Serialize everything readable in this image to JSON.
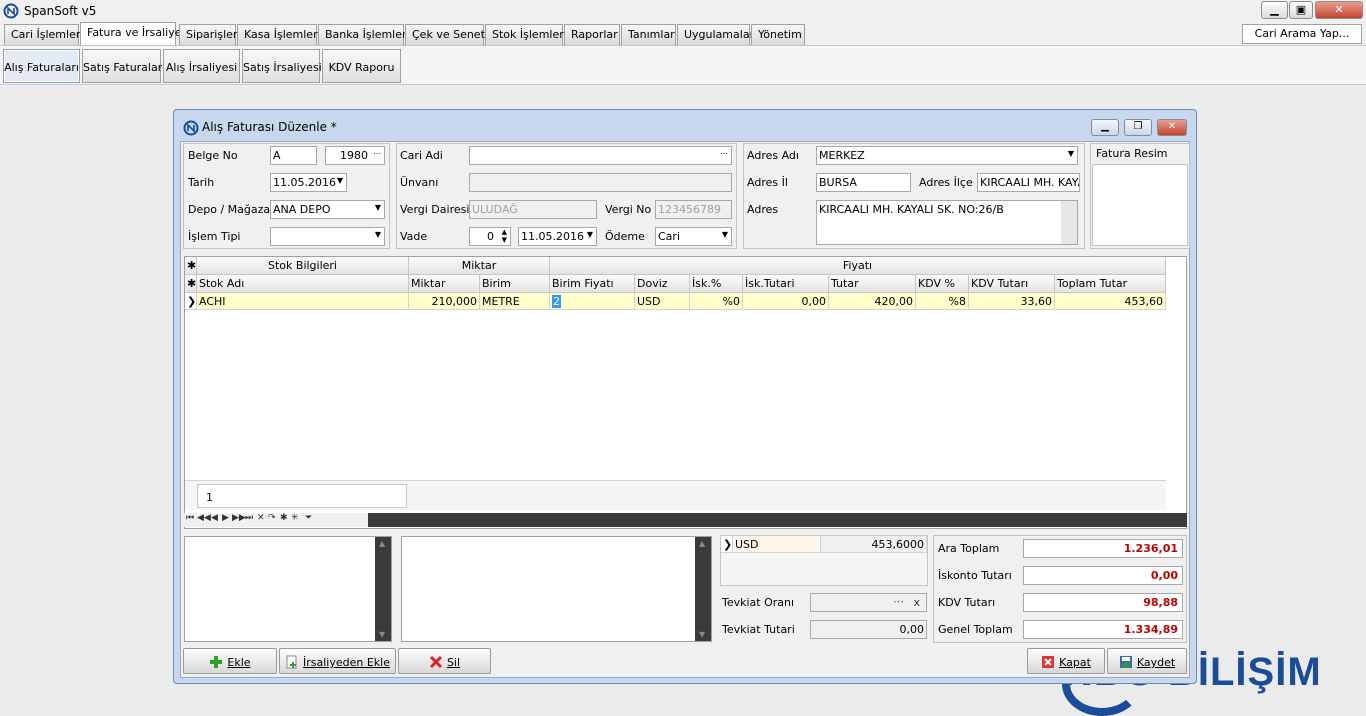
{
  "app": {
    "title": "SpanSoft v5"
  },
  "menu": {
    "tabs": [
      "Cari İşlemleri",
      "Fatura ve İrsaliye",
      "Siparişler",
      "Kasa İşlemleri",
      "Banka İşlemleri",
      "Çek ve Senet",
      "Stok İşlemleri",
      "Raporlar",
      "Tanımlar",
      "Uygulamalar",
      "Yönetim"
    ],
    "active": "Fatura ve İrsaliye",
    "search_label": "Cari Arama Yap..."
  },
  "submenu": {
    "tabs": [
      "Alış Faturaları",
      "Satış Faturaları",
      "Alış İrsaliyesi",
      "Satış İrsaliyesi",
      "KDV Raporu"
    ],
    "active": "Alış Faturaları"
  },
  "dialog": {
    "title": "Alış Faturası Düzenle *",
    "header": {
      "belge_no_label": "Belge No",
      "belge_seri": "A",
      "belge_no": "1980",
      "tarih_label": "Tarih",
      "tarih": "11.05.2016",
      "depo_label": "Depo / Mağaza",
      "depo": "ANA DEPO",
      "islem_tipi_label": "İşlem Tipi",
      "islem_tipi": "",
      "cari_adi_label": "Cari Adi",
      "cari_adi": "",
      "unvan_label": "Ünvanı",
      "unvan": "",
      "vergi_dairesi_label": "Vergi Dairesi",
      "vergi_dairesi": "ULUDAĞ",
      "vergi_no_label": "Vergi No",
      "vergi_no": "123456789",
      "vade_label": "Vade",
      "vade": "0",
      "vade_tarih": "11.05.2016",
      "odeme_label": "Ödeme",
      "odeme": "Cari",
      "adres_adi_label": "Adres Adı",
      "adres_adi": "MERKEZ",
      "adres_il_label": "Adres İl",
      "adres_il": "BURSA",
      "adres_ilce_label": "Adres İlçe",
      "adres_ilce": "KIRCAALI MH. KAYALI",
      "adres_label": "Adres",
      "adres": "KIRCAALI MH. KAYALI SK. NO:26/B",
      "fatura_resim_label": "Fatura Resim"
    },
    "grid": {
      "bands": {
        "stok": "Stok Bilgileri",
        "miktar": "Miktar",
        "fiyat": "Fiyatı"
      },
      "columns": [
        "Stok Adı",
        "Miktar",
        "Birim",
        "Birim Fiyatı",
        "Doviz",
        "İsk.%",
        "İsk.Tutari",
        "Tutar",
        "KDV %",
        "KDV Tutarı",
        "Toplam Tutar"
      ],
      "rows": [
        {
          "stok_adi": "ACHI",
          "miktar": "210,000",
          "birim": "METRE",
          "birim_fiyati": "2",
          "doviz": "USD",
          "isk_yuzde": "%0",
          "isk_tutari": "0,00",
          "tutar": "420,00",
          "kdv_yuzde": "%8",
          "kdv_tutari": "33,60",
          "toplam_tutar": "453,60"
        }
      ],
      "footer_count": "1"
    },
    "currency": {
      "code": "USD",
      "amount": "453,6000"
    },
    "tevkiat": {
      "oran_label": "Tevkiat Oranı",
      "oran_clear": "x",
      "tutar_label": "Tevkiat Tutari",
      "tutar": "0,00"
    },
    "totals": {
      "ara_toplam_label": "Ara Toplam",
      "ara_toplam": "1.236,01",
      "iskonto_label": "İskonto Tutarı",
      "iskonto": "0,00",
      "kdv_label": "KDV Tutarı",
      "kdv": "98,88",
      "genel_label": "Genel Toplam",
      "genel": "1.334,89"
    },
    "buttons": {
      "ekle": "Ekle",
      "irsaliyeden_ekle": "İrsaliyeden Ekle",
      "sil": "Sil",
      "kapat": "Kapat",
      "kaydet": "Kaydet"
    }
  },
  "watermark": "NBG BİLİŞİM"
}
